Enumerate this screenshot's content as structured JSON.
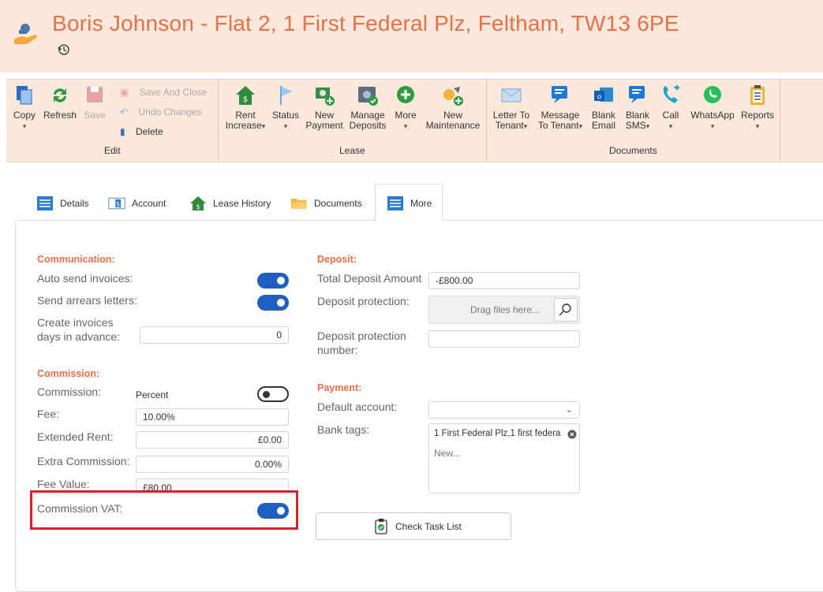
{
  "header": {
    "title": "Boris Johnson - Flat 2, 1 First Federal Plz, Feltham, TW13 6PE"
  },
  "ribbon": {
    "edit": {
      "copy": "Copy",
      "refresh": "Refresh",
      "save": "Save",
      "save_and_close": "Save And Close",
      "undo_changes": "Undo Changes",
      "delete": "Delete",
      "group": "Edit"
    },
    "lease": {
      "rent_increase_1": "Rent",
      "rent_increase_2": "Increase",
      "status": "Status",
      "new_payment_1": "New",
      "new_payment_2": "Payment",
      "manage_deposits_1": "Manage",
      "manage_deposits_2": "Deposits",
      "more": "More",
      "new_maintenance_1": "New",
      "new_maintenance_2": "Maintenance",
      "group": "Lease"
    },
    "documents": {
      "letter_1": "Letter To",
      "letter_2": "Tenant",
      "message_1": "Message",
      "message_2": "To Tenant",
      "blank_email_1": "Blank",
      "blank_email_2": "Email",
      "blank_sms_1": "Blank",
      "blank_sms_2": "SMS",
      "call": "Call",
      "whatsapp": "WhatsApp",
      "reports": "Reports",
      "group": "Documents"
    }
  },
  "tabs": [
    "Details",
    "Account",
    "Lease History",
    "Documents",
    "More"
  ],
  "communication": {
    "heading": "Communication:",
    "auto_send": "Auto send invoices:",
    "auto_send_on": true,
    "arrears": "Send arrears letters:",
    "arrears_on": true,
    "create_invoices_1": "Create invoices",
    "create_invoices_2": "days in advance:",
    "create_invoices_value": "0"
  },
  "commission": {
    "heading": "Commission:",
    "commission_label": "Commission:",
    "commission_type": "Percent",
    "commission_toggle_on": false,
    "fee_label": "Fee:",
    "fee_value": "10.00%",
    "extended_rent_label": "Extended Rent:",
    "extended_rent_value": "£0.00",
    "extra_commission_label": "Extra Commission:",
    "extra_commission_value": "0.00%",
    "fee_value_label": "Fee Value:",
    "fee_value_value": "£80.00",
    "vat_label": "Commission VAT:",
    "vat_on": true
  },
  "deposit": {
    "heading": "Deposit:",
    "total_label": "Total Deposit Amount",
    "total_value": "-£800.00",
    "protection_label": "Deposit protection:",
    "drag_placeholder": "Drag files here...",
    "protection_number_1": "Deposit protection",
    "protection_number_2": "number:",
    "protection_number_value": ""
  },
  "payment": {
    "heading": "Payment:",
    "default_account_label": "Default account:",
    "default_account_value": "",
    "bank_tags_label": "Bank tags:",
    "tag": "1 First Federal Plz,1 first federa",
    "new_placeholder": "New..."
  },
  "check_task_list": "Check Task List",
  "colors": {
    "accent": "#e8704a",
    "header_bg": "#fde8dc",
    "toggle_on": "#1e5fbf",
    "highlight": "#d9212a"
  }
}
